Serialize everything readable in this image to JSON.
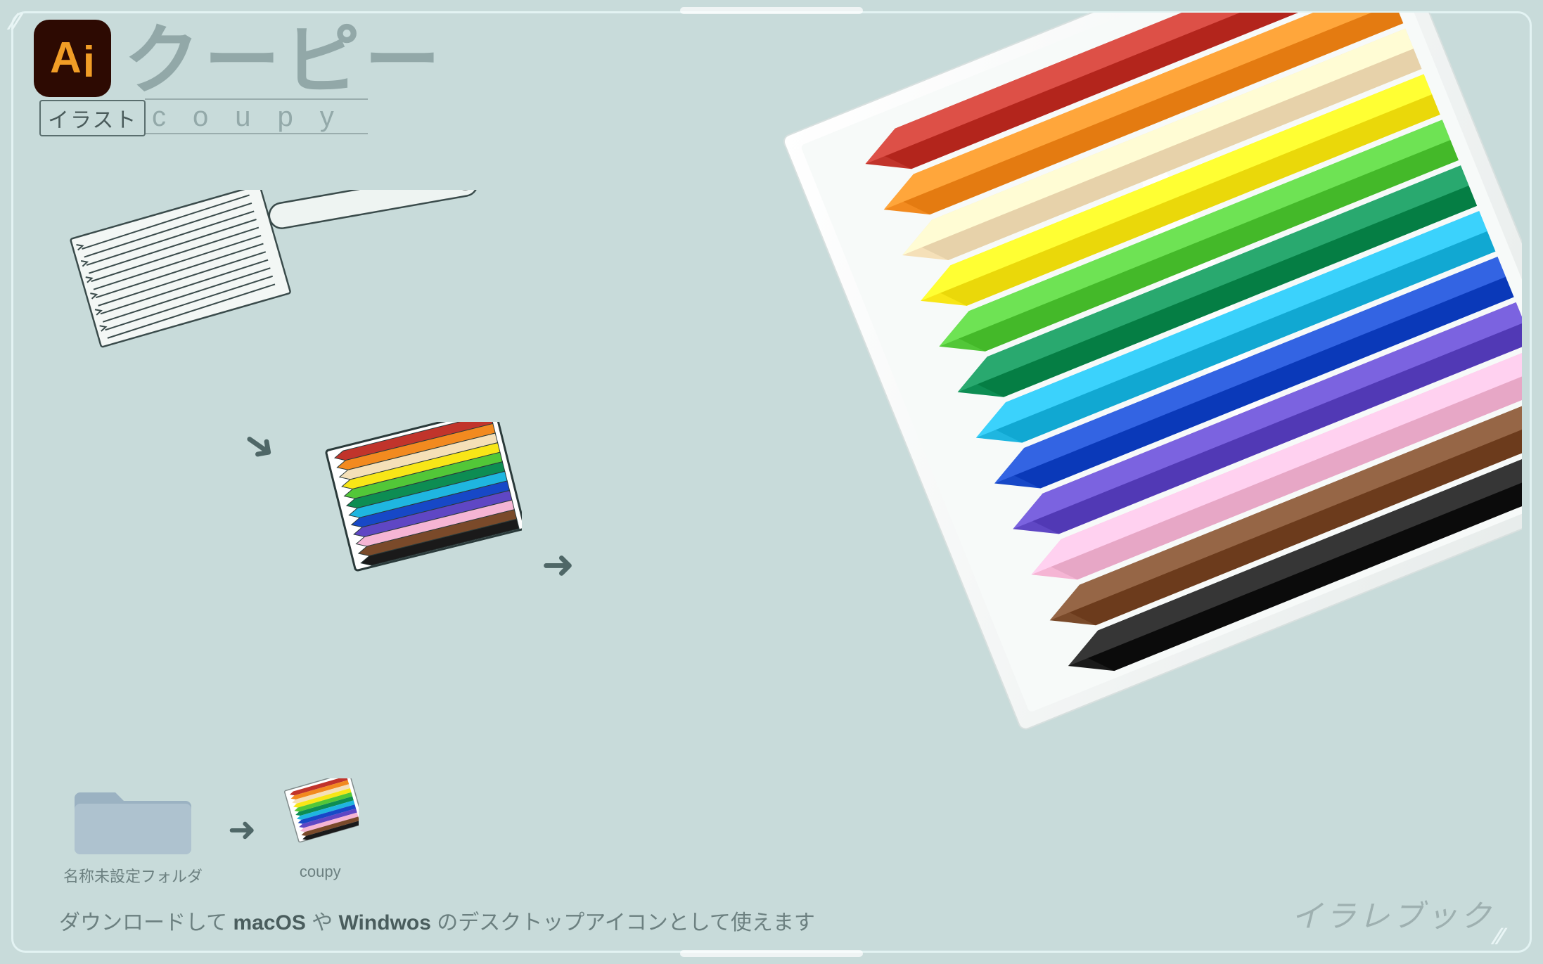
{
  "header": {
    "app_icon_letters": "Ai",
    "illust_label": "イラスト",
    "title_jp": "クーピー",
    "title_en": "coupy"
  },
  "folder": {
    "default_label": "名称未設定フォルダ",
    "coupy_label": "coupy"
  },
  "footer": {
    "prefix": "ダウンロードして ",
    "mac": "macOS",
    "mid": " や ",
    "win": "Windwos",
    "suffix": " のデスクトップアイコンとして使えます"
  },
  "watermark": "イラレブック",
  "crayon_colors": [
    "#c1342b",
    "#f28a1f",
    "#f5e0b8",
    "#f8e617",
    "#52c738",
    "#0d8d53",
    "#1fb6e0",
    "#1748c7",
    "#5f47c4",
    "#f5b5d4",
    "#7a4a2a",
    "#1a1a1a"
  ]
}
